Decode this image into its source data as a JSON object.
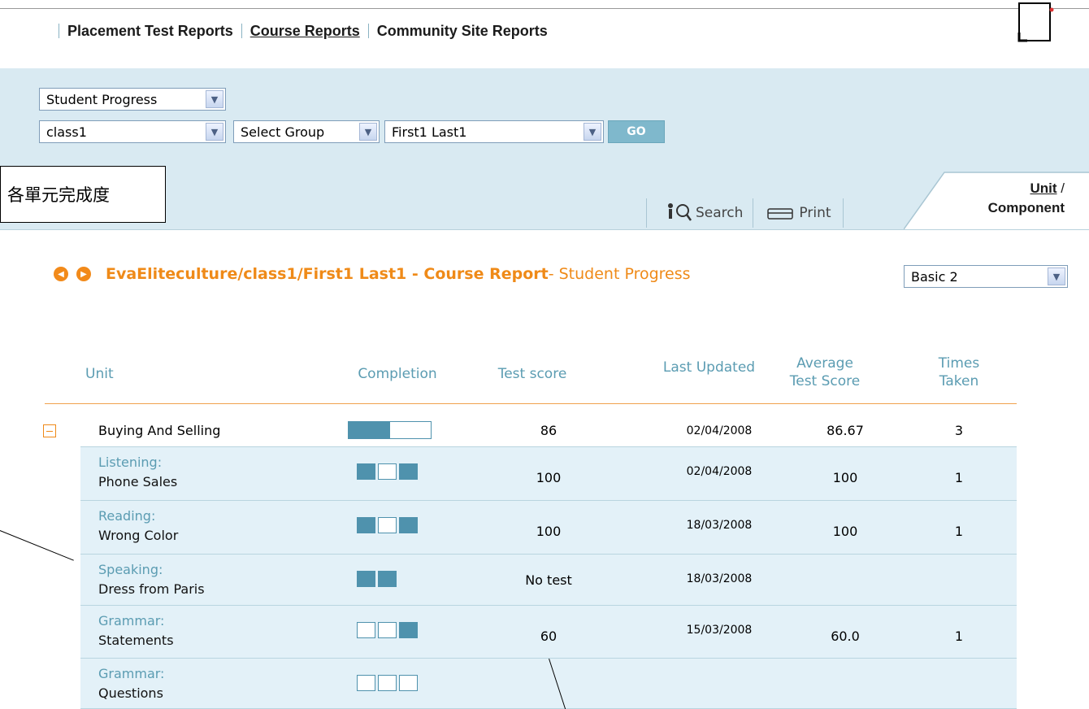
{
  "nav": {
    "items": [
      {
        "label": "Placement Test Reports",
        "active": false
      },
      {
        "label": "Course Reports",
        "active": true
      },
      {
        "label": "Community Site Reports",
        "active": false
      }
    ]
  },
  "filters": {
    "report_type": "Student Progress",
    "class": "class1",
    "group": "Select Group",
    "student": "First1 Last1",
    "go_label": "GO"
  },
  "callout": "各單元完成度",
  "toolbar": {
    "search_label": "Search",
    "print_label": "Print",
    "tab_unit": "Unit",
    "tab_sep": "/",
    "tab_component": "Component"
  },
  "report": {
    "title": "EvaEliteculture/class1/First1 Last1 - Course Report",
    "subtitle": " - Student Progress",
    "level": "Basic 2"
  },
  "table": {
    "headers": {
      "unit": "Unit",
      "completion": "Completion",
      "test_score": "Test score",
      "last_updated": "Last Updated",
      "avg_line1": "Average",
      "avg_line2": "Test Score",
      "times_line1": "Times",
      "times_line2": "Taken"
    },
    "unit_row": {
      "name": "Buying And Selling",
      "completion_pct": 50,
      "score": "86",
      "date": "02/04/2008",
      "avg": "86.67",
      "times": "3"
    },
    "components": [
      {
        "category": "Listening:",
        "name": "Phone Sales",
        "boxes": [
          1,
          0,
          1
        ],
        "score": "100",
        "date": "02/04/2008",
        "avg": "100",
        "times": "1"
      },
      {
        "category": "Reading:",
        "name": "Wrong Color",
        "boxes": [
          1,
          0,
          1
        ],
        "score": "100",
        "date": "18/03/2008",
        "avg": "100",
        "times": "1"
      },
      {
        "category": "Speaking:",
        "name": "Dress from Paris",
        "boxes": [
          1,
          1
        ],
        "score": "No test",
        "date": "18/03/2008",
        "avg": "",
        "times": ""
      },
      {
        "category": "Grammar:",
        "name": "Statements",
        "boxes": [
          0,
          0,
          1
        ],
        "score": "60",
        "date": "15/03/2008",
        "avg": "60.0",
        "times": "1"
      },
      {
        "category": "Grammar:",
        "name": "Questions",
        "boxes": [
          0,
          0,
          0
        ],
        "score": "",
        "date": "",
        "avg": "",
        "times": ""
      }
    ]
  },
  "colors": {
    "accent_orange": "#ef8a18",
    "panel_blue": "#d9eaf2",
    "fill_teal": "#4f92ad",
    "header_text": "#5b9cb2"
  }
}
